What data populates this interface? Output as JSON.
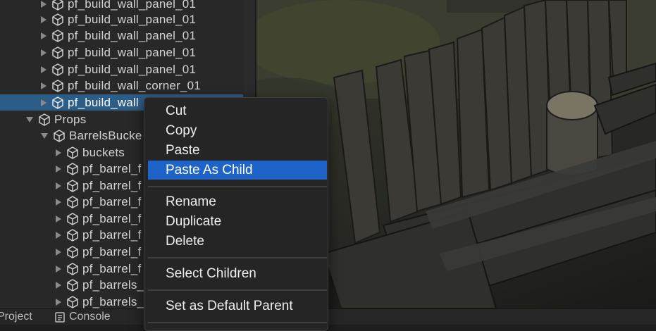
{
  "hierarchy": {
    "rows": [
      {
        "label": "pf_build_wall_panel_01"
      },
      {
        "label": "pf_build_wall_panel_01"
      },
      {
        "label": "pf_build_wall_panel_01"
      },
      {
        "label": "pf_build_wall_panel_01"
      },
      {
        "label": "pf_build_wall_panel_01"
      },
      {
        "label": "pf_build_wall_corner_01"
      },
      {
        "label": "pf_build_wall"
      },
      {
        "label": "Props"
      },
      {
        "label": "BarrelsBucke"
      },
      {
        "label": "buckets"
      },
      {
        "label": "pf_barrel_f"
      },
      {
        "label": "pf_barrel_f"
      },
      {
        "label": "pf_barrel_f"
      },
      {
        "label": "pf_barrel_f"
      },
      {
        "label": "pf_barrel_f"
      },
      {
        "label": "pf_barrel_f"
      },
      {
        "label": "pf_barrel_f"
      },
      {
        "label": "pf_barrels_"
      },
      {
        "label": "pf_barrels_"
      }
    ]
  },
  "context_menu": {
    "items": [
      {
        "label": "Cut"
      },
      {
        "label": "Copy"
      },
      {
        "label": "Paste"
      },
      {
        "label": "Paste As Child"
      },
      {
        "label": "Rename"
      },
      {
        "label": "Duplicate"
      },
      {
        "label": "Delete"
      },
      {
        "label": "Select Children"
      },
      {
        "label": "Set as Default Parent"
      }
    ]
  },
  "tabs": {
    "project": "Project",
    "console": "Console"
  },
  "icons": {
    "tree_collapsed": "chevron-right-icon",
    "tree_expanded": "chevron-down-icon",
    "game_object": "cube-icon",
    "console": "console-icon"
  },
  "colors": {
    "selection": "#2c5d87",
    "menu_highlight": "#1e64c8"
  }
}
